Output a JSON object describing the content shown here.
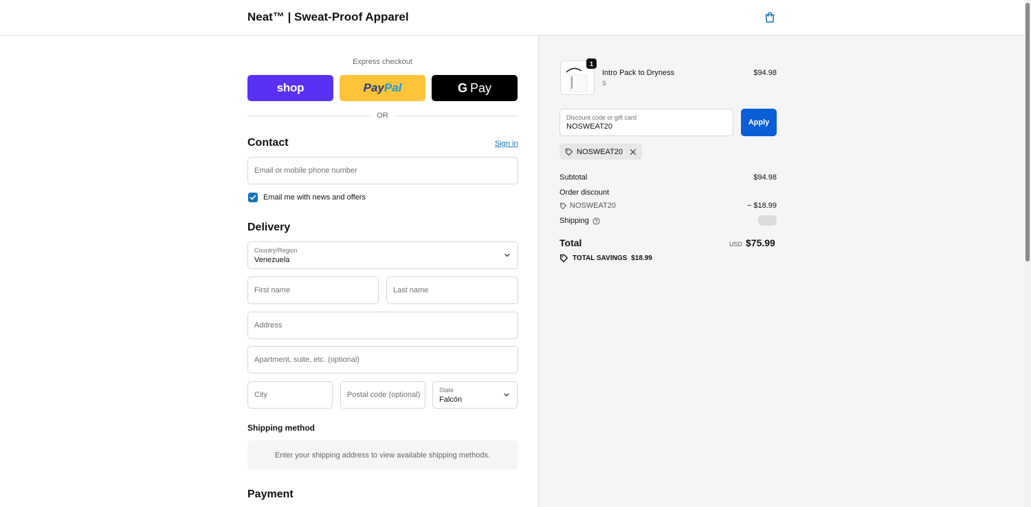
{
  "header": {
    "store_name": "Neat™ | Sweat-Proof Apparel",
    "icons": {
      "cart": "shopping-bag-icon"
    }
  },
  "express": {
    "label": "Express checkout",
    "shop_label": "shop",
    "paypal_part1": "Pay",
    "paypal_part2": "Pal",
    "gpay_g": "G",
    "gpay_label": "Pay",
    "or_label": "OR"
  },
  "contact": {
    "title": "Contact",
    "sign_in": "Sign in",
    "email_placeholder": "Email or mobile phone number",
    "news_label": "Email me with news and offers",
    "news_checked": true
  },
  "delivery": {
    "title": "Delivery",
    "country_label": "Country/Region",
    "country_value": "Venezuela",
    "first_name_placeholder": "First name",
    "last_name_placeholder": "Last name",
    "address_placeholder": "Address",
    "apartment_placeholder": "Apartment, suite, etc. (optional)",
    "city_placeholder": "City",
    "postal_placeholder": "Postal code (optional)",
    "state_label": "State",
    "state_value": "Falcón"
  },
  "shipping_method": {
    "title": "Shipping method",
    "notice": "Enter your shipping address to view available shipping methods."
  },
  "payment": {
    "title": "Payment"
  },
  "summary": {
    "product": {
      "name": "Intro Pack to Dryness",
      "variant": "S",
      "price": "$94.98",
      "quantity": "1"
    },
    "discount_label": "Discount code or gift card",
    "discount_value": "NOSWEAT20",
    "apply_label": "Apply",
    "applied_code": "NOSWEAT20",
    "subtotal_label": "Subtotal",
    "subtotal_value": "$94.98",
    "order_discount_label": "Order discount",
    "order_discount_code": "NOSWEAT20",
    "order_discount_value": "− $18.99",
    "shipping_label": "Shipping",
    "total_label": "Total",
    "currency": "USD",
    "total_value": "$75.99",
    "savings_label": "TOTAL SAVINGS",
    "savings_value": "$18.99"
  },
  "colors": {
    "accent": "#1773b0",
    "apply": "#0b5ed7",
    "shop": "#5a31f4",
    "paypal": "#ffc439"
  }
}
